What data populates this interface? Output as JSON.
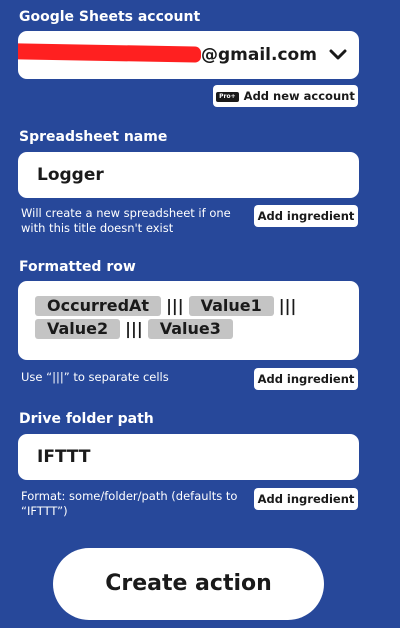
{
  "account": {
    "label": "Google Sheets account",
    "email_suffix": "@gmail.com",
    "pro_badge": "Pro+",
    "add_account_label": "Add new account"
  },
  "spreadsheet": {
    "label": "Spreadsheet name",
    "value": "Logger",
    "helper": "Will create a new spreadsheet if one with this title doesn't exist",
    "add_ingredient": "Add ingredient"
  },
  "row": {
    "label": "Formatted row",
    "pills": [
      "OccurredAt",
      "Value1",
      "Value2",
      "Value3"
    ],
    "separator": "|||",
    "helper": "Use “|||” to separate cells",
    "add_ingredient": "Add ingredient"
  },
  "folder": {
    "label": "Drive folder path",
    "value": "IFTTT",
    "helper": "Format: some/folder/path (defaults to “IFTTT”)",
    "add_ingredient": "Add ingredient"
  },
  "create_action_label": "Create action",
  "colors": {
    "background": "#27489a",
    "redaction": "#ff2020",
    "pill": "#c4c4c4"
  }
}
